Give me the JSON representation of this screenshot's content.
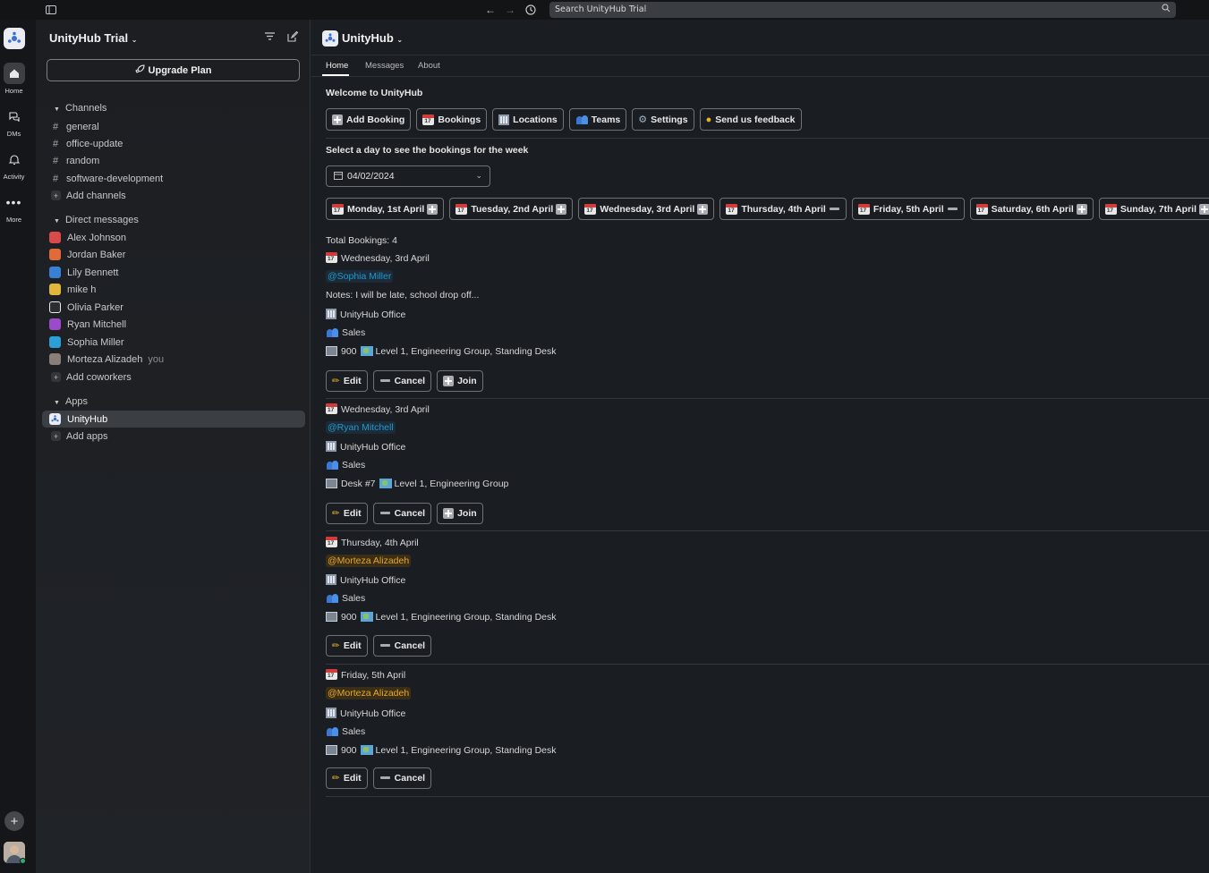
{
  "topbar": {
    "search_placeholder": "Search UnityHub Trial"
  },
  "rail": {
    "items": [
      {
        "label": "Home",
        "icon": "home-icon"
      },
      {
        "label": "DMs",
        "icon": "dms-icon"
      },
      {
        "label": "Activity",
        "icon": "bell-icon"
      },
      {
        "label": "More",
        "icon": "more-icon"
      }
    ]
  },
  "sidebar": {
    "workspace_name": "UnityHub Trial",
    "upgrade_label": "Upgrade Plan",
    "channels_header": "Channels",
    "channels": [
      "general",
      "office-update",
      "random",
      "software-development"
    ],
    "add_channels": "Add channels",
    "dm_header": "Direct messages",
    "dms": [
      {
        "name": "Alex Johnson",
        "color": "#d94b4b"
      },
      {
        "name": "Jordan Baker",
        "color": "#e06a3a"
      },
      {
        "name": "Lily Bennett",
        "color": "#3a7fd6"
      },
      {
        "name": "mike h",
        "color": "#e0b93a"
      },
      {
        "name": "Olivia Parker",
        "color": "#e8e8e8"
      },
      {
        "name": "Ryan Mitchell",
        "color": "#9b4bc9"
      },
      {
        "name": "Sophia Miller",
        "color": "#2b9fd6"
      },
      {
        "name": "Morteza Alizadeh",
        "color": "#8a7f78"
      }
    ],
    "you_label": "you",
    "add_coworkers": "Add coworkers",
    "apps_header": "Apps",
    "apps": [
      "UnityHub"
    ],
    "add_apps": "Add apps"
  },
  "app": {
    "title": "UnityHub",
    "tabs": [
      "Home",
      "Messages",
      "About"
    ],
    "welcome": "Welcome to UnityHub",
    "buttons": [
      {
        "label": "Add Booking",
        "icon": "plus-icon"
      },
      {
        "label": "Bookings",
        "icon": "calendar-icon"
      },
      {
        "label": "Locations",
        "icon": "building-icon"
      },
      {
        "label": "Teams",
        "icon": "people-icon"
      },
      {
        "label": "Settings",
        "icon": "gear-icon"
      },
      {
        "label": "Send us feedback",
        "icon": "medal-icon"
      }
    ],
    "hint": "Select a day to see the bookings for the week",
    "date_value": "04/02/2024",
    "days": [
      {
        "label": "Monday, 1st April",
        "state": "plus"
      },
      {
        "label": "Tuesday, 2nd April",
        "state": "plus"
      },
      {
        "label": "Wednesday, 3rd April",
        "state": "plus"
      },
      {
        "label": "Thursday, 4th April",
        "state": "minus"
      },
      {
        "label": "Friday, 5th April",
        "state": "minus"
      },
      {
        "label": "Saturday, 6th April",
        "state": "plus"
      },
      {
        "label": "Sunday, 7th April",
        "state": "plus"
      }
    ],
    "total": "Total Bookings: 4",
    "bookings": [
      {
        "day": "Wednesday, 3rd April",
        "user": "@Sophia Miller",
        "notes": "Notes: I will be late, school drop off...",
        "office": "UnityHub Office",
        "team": "Sales",
        "desk": "900",
        "location": "Level 1, Engineering Group, Standing Desk",
        "actions": [
          "Edit",
          "Cancel",
          "Join"
        ]
      },
      {
        "day": "Wednesday, 3rd April",
        "user": "@Ryan Mitchell",
        "office": "UnityHub Office",
        "team": "Sales",
        "desk": "Desk #7",
        "location": "Level 1, Engineering Group",
        "actions": [
          "Edit",
          "Cancel",
          "Join"
        ]
      },
      {
        "day": "Thursday, 4th April",
        "user": "@Morteza Alizadeh",
        "office": "UnityHub Office",
        "team": "Sales",
        "desk": "900",
        "location": "Level 1, Engineering Group, Standing Desk",
        "actions": [
          "Edit",
          "Cancel"
        ]
      },
      {
        "day": "Friday, 5th April",
        "user": "@Morteza Alizadeh",
        "office": "UnityHub Office",
        "team": "Sales",
        "desk": "900",
        "location": "Level 1, Engineering Group, Standing Desk",
        "actions": [
          "Edit",
          "Cancel"
        ]
      }
    ]
  }
}
